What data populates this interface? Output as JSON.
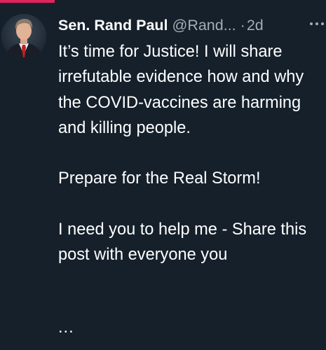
{
  "tweet": {
    "display_name": "Sen. Rand Paul",
    "handle": "@Rand...",
    "separator": "·",
    "timestamp": "2d",
    "paragraphs": [
      "It’s time for Justice! I will share irrefutable evidence how and why the COVID-vaccines are harming and killing people.",
      "Prepare for the Real Storm!",
      "I need you to help me - Share this post with everyone you"
    ],
    "truncation": "...",
    "avatar_icon": "person-avatar-icon",
    "menu_icon": "more-options-icon"
  },
  "colors": {
    "background": "#15202b",
    "text": "#ffffff",
    "secondary_text": "#a3adb6",
    "accent": "#e0245e"
  }
}
